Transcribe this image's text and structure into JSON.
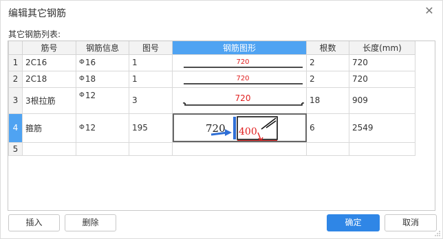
{
  "dialog": {
    "title": "编辑其它钢筋",
    "close_label": "✕",
    "list_label": "其它钢筋列表:"
  },
  "table": {
    "columns": [
      "",
      "筋号",
      "钢筋信息",
      "图号",
      "钢筋图形",
      "根数",
      "长度(mm)"
    ],
    "selected_column": 4,
    "selected_row": 4,
    "rows": [
      {
        "num": "1",
        "name": "2C16",
        "steel_symbol": "Φ",
        "steel": "16",
        "figure": "1",
        "shape_label": "720",
        "count": "2",
        "length": "720"
      },
      {
        "num": "2",
        "name": "2C18",
        "steel_symbol": "Φ",
        "steel": "18",
        "figure": "1",
        "shape_label": "720",
        "count": "2",
        "length": "720"
      },
      {
        "num": "3",
        "name": "3根拉筋",
        "steel_symbol": "Φ",
        "steel": "12",
        "figure": "3",
        "shape_label": "720",
        "count": "18",
        "length": "909"
      },
      {
        "num": "4",
        "name": "箍筋",
        "steel_symbol": "Φ",
        "steel": "12",
        "figure": "195",
        "shape_label_a": "720",
        "shape_label_b": "400",
        "count": "6",
        "length": "2549"
      },
      {
        "num": "5",
        "name": "",
        "steel_symbol": "",
        "steel": "",
        "figure": "",
        "count": "",
        "length": ""
      }
    ]
  },
  "buttons": {
    "insert": "插入",
    "delete": "删除",
    "ok": "确定",
    "cancel": "取消"
  },
  "colors": {
    "accent": "#2f86e6",
    "header_selected": "#4fa3f2",
    "label_red": "#e02020",
    "arrow_blue": "#2f6fd6"
  }
}
